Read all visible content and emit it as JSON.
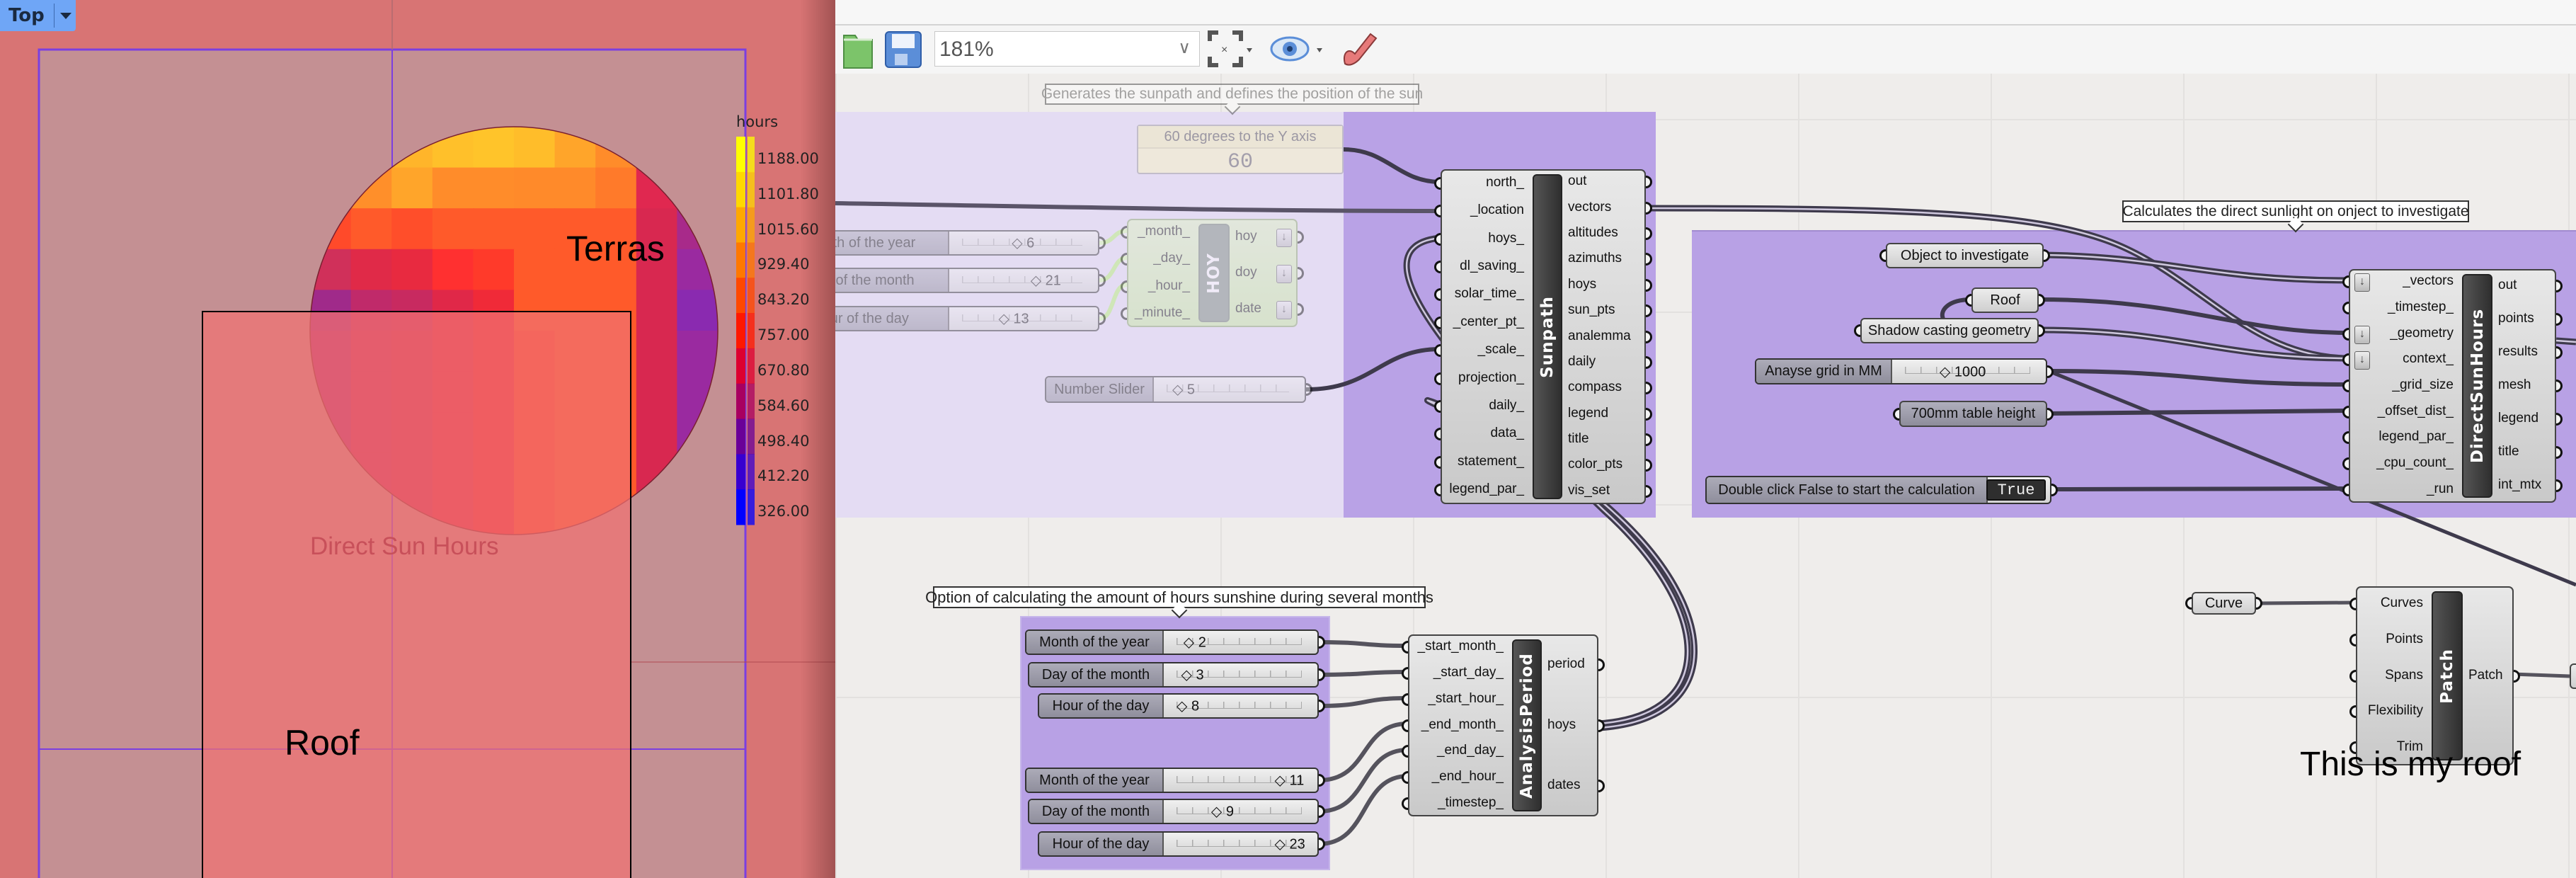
{
  "viewport": {
    "view_label": "Top",
    "legend": {
      "title": "hours",
      "values": [
        "1188.00",
        "1101.80",
        "1015.60",
        "929.40",
        "843.20",
        "757.00",
        "670.80",
        "584.60",
        "498.40",
        "412.20",
        "326.00"
      ],
      "colors": [
        "#ffff00",
        "#ffd800",
        "#ffa800",
        "#ff7800",
        "#ff4800",
        "#ff1800",
        "#dd0030",
        "#a80060",
        "#6a0098",
        "#3800d0",
        "#0000ff"
      ]
    },
    "labels": {
      "terras": "Terras",
      "roof": "Roof",
      "result_title": "Direct Sun Hours"
    }
  },
  "toolbar": {
    "zoom": "181%"
  },
  "sunpath_group": {
    "tooltip": "Generates the sunpath and defines the position of the sun",
    "north_panel": {
      "title": "60 degrees to the Y axis",
      "value": "60"
    },
    "sliders": [
      {
        "label": "Month of the year",
        "value": "6"
      },
      {
        "label": "Day of the month",
        "value": "21"
      },
      {
        "label": "Hour of the day",
        "value": "13"
      }
    ],
    "number_slider": {
      "label": "Number Slider",
      "value": "5"
    }
  },
  "hoy": {
    "title": "HOY",
    "inputs": [
      "_month_",
      "_day_",
      "_hour_",
      "_minute_"
    ],
    "outputs": [
      "hoy",
      "doy",
      "date"
    ]
  },
  "sunpath": {
    "title": "Sunpath",
    "inputs": [
      "north_",
      "_location",
      "hoys_",
      "dl_saving_",
      "solar_time_",
      "_center_pt_",
      "_scale_",
      "projection_",
      "daily_",
      "data_",
      "statement_",
      "legend_par_"
    ],
    "outputs": [
      "out",
      "vectors",
      "altitudes",
      "azimuths",
      "hoys",
      "sun_pts",
      "analemma",
      "daily",
      "compass",
      "legend",
      "title",
      "color_pts",
      "vis_set"
    ]
  },
  "dsh_group": {
    "tooltip": "Calculates the direct sunlight on onject to investigate",
    "params": {
      "object": "Object to investigate",
      "roof": "Roof",
      "shadow": "Shadow casting geometry",
      "table": "700mm table height"
    },
    "grid_slider": {
      "label": "Anayse grid in MM",
      "value": "1000"
    },
    "toggle": {
      "label": "Double click False to start the calculation",
      "value": "True"
    }
  },
  "dsh": {
    "title": "DirectSunHours",
    "inputs": [
      "_vectors",
      "_timestep_",
      "_geometry",
      "context_",
      "_grid_size",
      "_offset_dist_",
      "legend_par_",
      "_cpu_count_",
      "_run"
    ],
    "outputs": [
      "out",
      "points",
      "results",
      "mesh",
      "legend",
      "title",
      "int_mtx"
    ]
  },
  "period_group": {
    "tooltip": "Option of calculating the amount of hours sunshine during several months",
    "sliders": [
      {
        "label": "Month of the year",
        "value": "2"
      },
      {
        "label": "Day of the month",
        "value": "3"
      },
      {
        "label": "Hour of the day",
        "value": "8"
      },
      {
        "label": "Month of the year",
        "value": "11"
      },
      {
        "label": "Day of the month",
        "value": "9"
      },
      {
        "label": "Hour of the day",
        "value": "23"
      }
    ]
  },
  "analysis_period": {
    "title": "AnalysisPeriod",
    "inputs": [
      "_start_month_",
      "_start_day_",
      "_start_hour_",
      "_end_month_",
      "_end_day_",
      "_end_hour_",
      "_timestep_"
    ],
    "outputs": [
      "period",
      "hoys",
      "dates"
    ]
  },
  "patch": {
    "curve_param": "Curve",
    "title": "Patch",
    "inputs": [
      "Curves",
      "Points",
      "Spans",
      "Flexibility",
      "Trim"
    ],
    "outputs": [
      "Patch"
    ],
    "note": "This is my roof"
  }
}
